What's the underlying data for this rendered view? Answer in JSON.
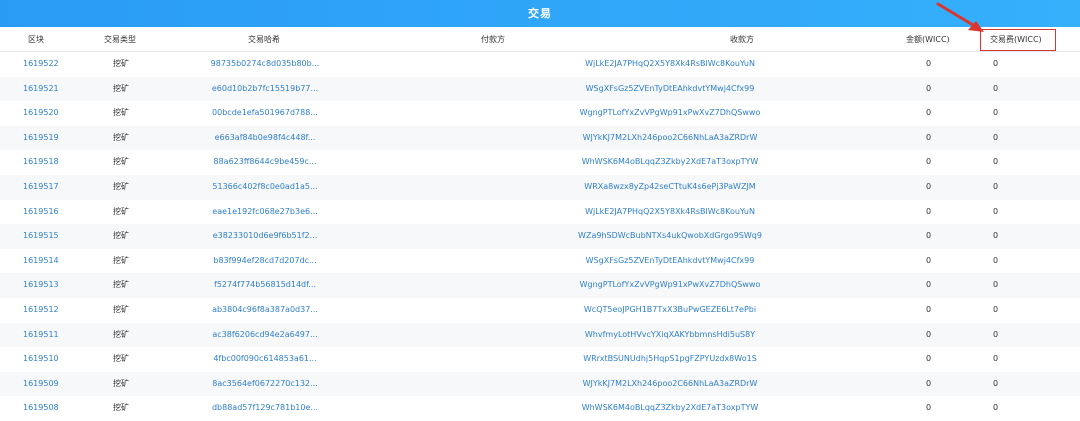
{
  "header": {
    "title": "交易"
  },
  "columns": {
    "block": "区块",
    "type": "交易类型",
    "hash": "交易哈希",
    "from": "付款方",
    "to": "收款方",
    "amount": "金额(WICC)",
    "fee": "交易费(WICC)"
  },
  "rows": [
    {
      "block": "1619522",
      "type": "挖矿",
      "hash": "98735b0274c8d035b80b...",
      "to": "WjLkE2JA7PHqQ2X5Y8Xk4RsBlWc8KouYuN",
      "amount": "0",
      "fee": "0"
    },
    {
      "block": "1619521",
      "type": "挖矿",
      "hash": "e60d10b2b7fc15519b77...",
      "to": "WSgXFsGz5ZVEnTyDtEAhkdvtYMwj4Cfx99",
      "amount": "0",
      "fee": "0"
    },
    {
      "block": "1619520",
      "type": "挖矿",
      "hash": "00bcde1efa501967d788...",
      "to": "WgngPTLofYxZvVPgWp91xPwXvZ7DhQSwwo",
      "amount": "0",
      "fee": "0"
    },
    {
      "block": "1619519",
      "type": "挖矿",
      "hash": "e663af84b0e98f4c448f...",
      "to": "WJYkKJ7M2LXh246poo2C66NhLaA3aZRDrW",
      "amount": "0",
      "fee": "0"
    },
    {
      "block": "1619518",
      "type": "挖矿",
      "hash": "88a623ff8644c9be459c...",
      "to": "WhWSK6M4oBLqqZ3Zkby2XdE7aT3oxpTYW",
      "amount": "0",
      "fee": "0"
    },
    {
      "block": "1619517",
      "type": "挖矿",
      "hash": "51366c402f8c0e0ad1a5...",
      "to": "WRXa8wzx8yZp42seCTtuK4s6ePj3PaWZJM",
      "amount": "0",
      "fee": "0"
    },
    {
      "block": "1619516",
      "type": "挖矿",
      "hash": "eae1e192fc068e27b3e6...",
      "to": "WjLkE2JA7PHqQ2X5Y8Xk4RsBlWc8KouYuN",
      "amount": "0",
      "fee": "0"
    },
    {
      "block": "1619515",
      "type": "挖矿",
      "hash": "e38233010d6e9f6b51f2...",
      "to": "WZa9hSDWcBubNTXs4ukQwobXdGrgo9SWq9",
      "amount": "0",
      "fee": "0"
    },
    {
      "block": "1619514",
      "type": "挖矿",
      "hash": "b83f994ef28cd7d207dc...",
      "to": "WSgXFsGz5ZVEnTyDtEAhkdvtYMwj4Cfx99",
      "amount": "0",
      "fee": "0"
    },
    {
      "block": "1619513",
      "type": "挖矿",
      "hash": "f5274f774b56815d14df...",
      "to": "WgngPTLofYxZvVPgWp91xPwXvZ7DhQSwwo",
      "amount": "0",
      "fee": "0"
    },
    {
      "block": "1619512",
      "type": "挖矿",
      "hash": "ab3804c96f8a387a0d37...",
      "to": "WcQT5eoJPGH1B7TxX3BuPwGEZE6Lt7ePbi",
      "amount": "0",
      "fee": "0"
    },
    {
      "block": "1619511",
      "type": "挖矿",
      "hash": "ac38f6206cd94e2a6497...",
      "to": "WhvfmyLotHVvcYXiqXAKYbbmnsHdi5uS8Y",
      "amount": "0",
      "fee": "0"
    },
    {
      "block": "1619510",
      "type": "挖矿",
      "hash": "4fbc00f090c614853a61...",
      "to": "WRrxtBSUNUdhj5HqpS1pgFZPYUzdx8Wo1S",
      "amount": "0",
      "fee": "0"
    },
    {
      "block": "1619509",
      "type": "挖矿",
      "hash": "8ac3564ef0672270c132...",
      "to": "WJYkKJ7M2LXh246poo2C66NhLaA3aZRDrW",
      "amount": "0",
      "fee": "0"
    },
    {
      "block": "1619508",
      "type": "挖矿",
      "hash": "db88ad57f129c781b10e...",
      "to": "WhWSK6M4oBLqqZ3Zkby2XdE7aT3oxpTYW",
      "amount": "0",
      "fee": "0"
    }
  ],
  "colors": {
    "header_bg": "#2a9bf5",
    "link": "#2f7fc8",
    "highlight": "#d9362f"
  },
  "annotation": {
    "icon": "red-arrow-icon"
  }
}
